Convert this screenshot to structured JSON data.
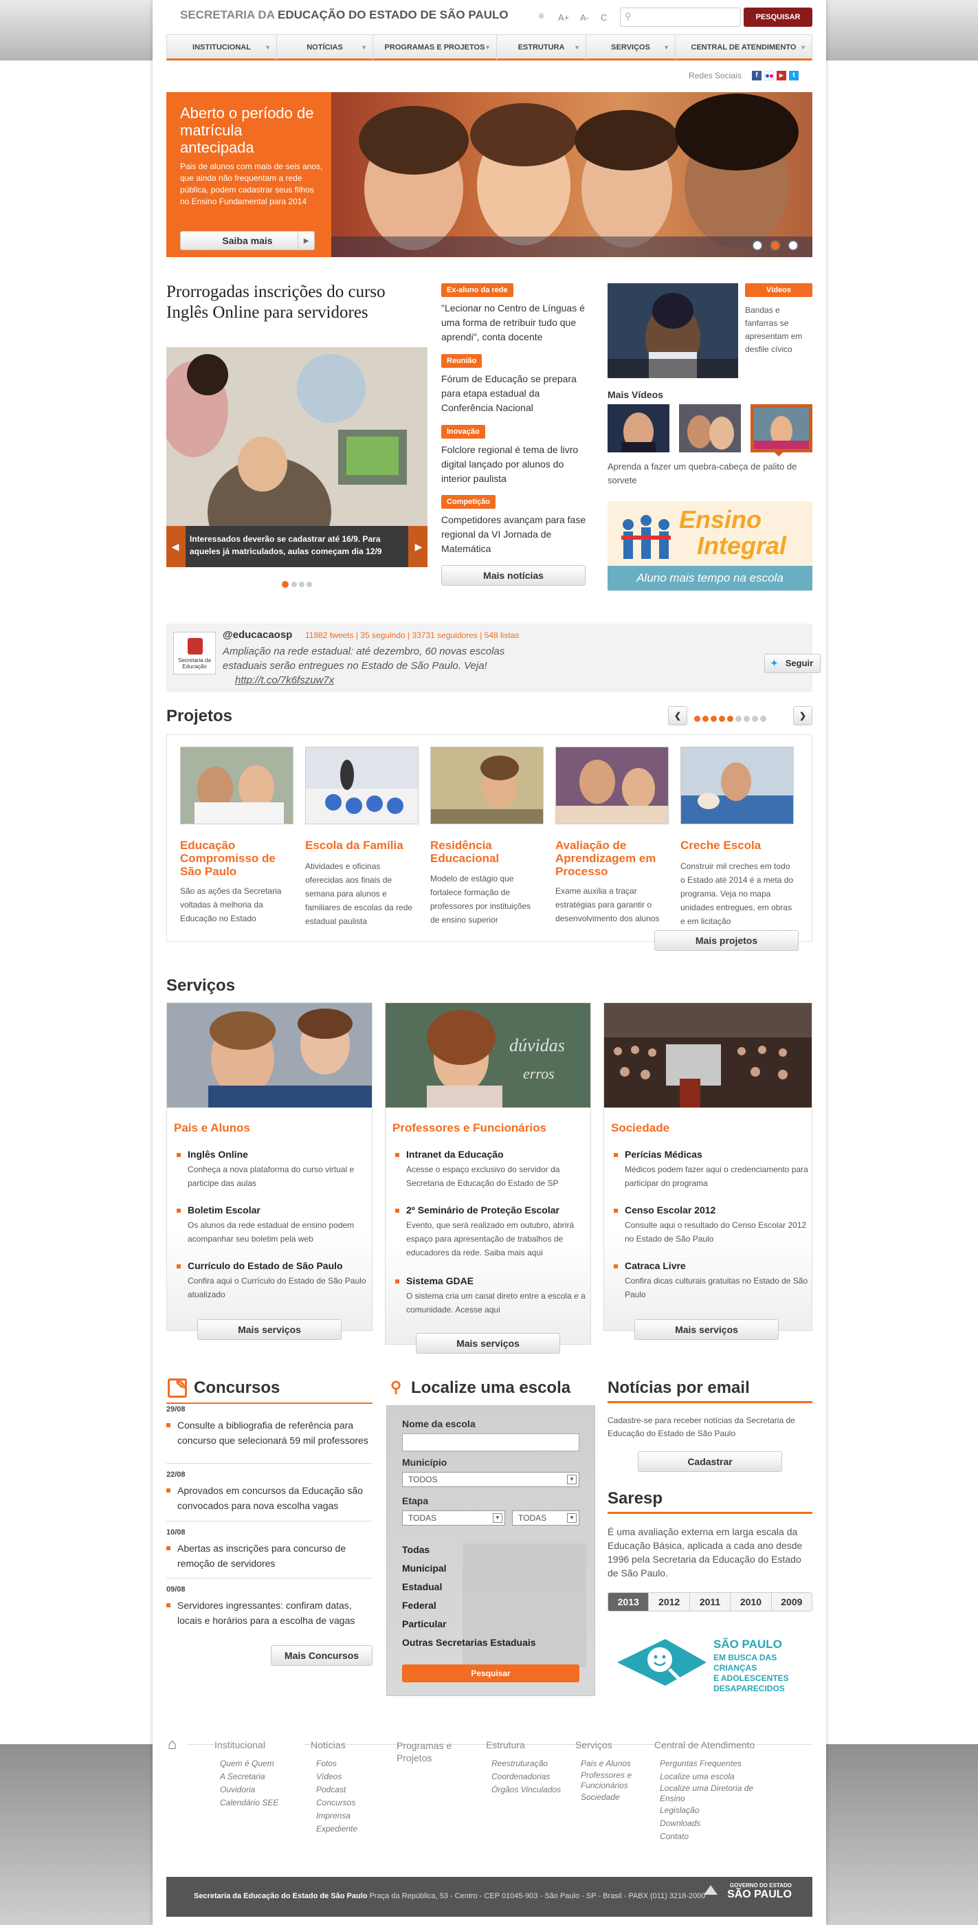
{
  "header": {
    "title_light": "SECRETARIA DA",
    "title_bold": "EDUCAÇÃO DO ESTADO DE SÃO PAULO",
    "font_up": "A+",
    "font_down": "A-",
    "contrast": "C",
    "search_placeholder": "",
    "search_button": "PESQUISAR"
  },
  "nav": {
    "items": [
      {
        "label": "INSTITUCIONAL"
      },
      {
        "label": "NOTÍCIAS"
      },
      {
        "label": "PROGRAMAS E PROJETOS"
      },
      {
        "label": "ESTRUTURA"
      },
      {
        "label": "SERVIÇOS"
      },
      {
        "label": "CENTRAL DE ATENDIMENTO"
      }
    ]
  },
  "social": {
    "label": "Redes Sociais"
  },
  "hero": {
    "title": "Aberto o período de matrícula antecipada",
    "text": "Pais de alunos com mais de seis anos, que ainda não frequentam a rede pública, podem cadastrar seus filhos no Ensino Fundamental para 2014",
    "button": "Saiba mais"
  },
  "news": {
    "headline": "Prorrogadas inscrições do curso Inglês Online para servidores",
    "caption": "Interessados deverão se cadastrar até 16/9. Para aqueles já matriculados, aulas começam dia 12/9",
    "items": [
      {
        "tag": "Ex-aluno da rede",
        "text": "\"Lecionar no Centro de Línguas é uma forma de retribuir tudo que aprendi\", conta docente"
      },
      {
        "tag": "Reunião",
        "text": "Fórum de Educação se prepara para etapa estadual da Conferência Nacional"
      },
      {
        "tag": "Inovação",
        "text": "Folclore regional é tema de livro digital lançado por alunos do interior paulista"
      },
      {
        "tag": "Competição",
        "text": "Competidores avançam para fase regional da VI Jornada de Matemática"
      }
    ],
    "more": "Mais notícias"
  },
  "videos": {
    "tag": "Vídeos",
    "text": "Bandas e fanfarras se apresentam em desfile cívico",
    "more_title": "Mais Vídeos",
    "caption": "Aprenda a fazer um quebra-cabeça de palito de sorvete"
  },
  "banner": {
    "title1": "Ensino",
    "title2": "Integral",
    "subtitle": "Aluno mais tempo na escola"
  },
  "twitter": {
    "handle": "@educacaosp",
    "stats": "11882 tweets | 35 seguindo | 33731 seguidores | 548 listas",
    "tweet": "Ampliação na rede estadual: até dezembro, 60 novas escolas estaduais serão entregues no Estado de São Paulo. Veja!",
    "link": "http://t.co/7k6fszuw7x",
    "follow": "Seguir",
    "avatar_text": "Secretaria da Educação"
  },
  "projects": {
    "title": "Projetos",
    "items": [
      {
        "title": "Educação Compromisso de São Paulo",
        "text": "São as ações da Secretaria voltadas à melhoria da Educação no Estado"
      },
      {
        "title": "Escola da Família",
        "text": "Atividades e oficinas oferecidas aos finais de semana para alunos e familiares de escolas da rede estadual paulista"
      },
      {
        "title": "Residência Educacional",
        "text": "Modelo de estágio que fortalece formação de professores por instituições de ensino superior"
      },
      {
        "title": "Avaliação de Aprendizagem em Processo",
        "text": "Exame auxilia a traçar estratégias para garantir o desenvolvimento dos alunos"
      },
      {
        "title": "Creche Escola",
        "text": "Construir mil creches em todo o Estado até 2014 é a meta do programa. Veja no mapa unidades entregues, em obras e em licitação"
      }
    ],
    "more": "Mais projetos"
  },
  "services": {
    "title": "Serviços",
    "cols": [
      {
        "title": "Pais e Alunos",
        "items": [
          {
            "t": "Inglês Online",
            "d": "Conheça a nova plataforma do curso virtual e participe das aulas"
          },
          {
            "t": "Boletim Escolar",
            "d": "Os alunos da rede estadual de ensino podem acompanhar seu boletim pela web"
          },
          {
            "t": "Currículo do Estado de São Paulo",
            "d": "Confira aqui o Currículo do Estado de São Paulo atualizado"
          }
        ]
      },
      {
        "title": "Professores e Funcionários",
        "items": [
          {
            "t": "Intranet da Educação",
            "d": "Acesse o espaço exclusivo do servidor da Secretaria de Educação do Estado de SP"
          },
          {
            "t": "2º Seminário de Proteção Escolar",
            "d": "Evento, que será realizado em outubro, abrirá espaço para apresentação de trabalhos de educadores da rede. Saiba mais aqui"
          },
          {
            "t": "Sistema GDAE",
            "d": "O sistema cria um canal direto entre a escola e a comunidade. Acesse aqui"
          }
        ]
      },
      {
        "title": "Sociedade",
        "items": [
          {
            "t": "Perícias Médicas",
            "d": "Médicos podem fazer aqui o credenciamento para participar do programa"
          },
          {
            "t": "Censo Escolar 2012",
            "d": "Consulte aqui o resultado do Censo Escolar 2012 no Estado de São Paulo"
          },
          {
            "t": "Catraca Livre",
            "d": "Confira dicas culturais gratuitas no Estado de São Paulo"
          }
        ]
      }
    ],
    "more": "Mais serviços"
  },
  "concursos": {
    "title": "Concursos",
    "items": [
      {
        "date": "29/08",
        "text": "Consulte a bibliografia de referência para concurso que selecionará 59 mil professores"
      },
      {
        "date": "22/08",
        "text": "Aprovados em concursos da Educação são convocados para nova escolha vagas"
      },
      {
        "date": "10/08",
        "text": "Abertas as inscrições para concurso de remoção de servidores"
      },
      {
        "date": "09/08",
        "text": "Servidores ingressantes: confiram datas, locais e horários para a escolha de vagas"
      }
    ],
    "more": "Mais Concursos"
  },
  "localize": {
    "title": "Localize uma escola",
    "name_label": "Nome da escola",
    "mun_label": "Município",
    "mun_value": "TODOS",
    "etapa_label": "Etapa",
    "etapa_value1": "TODAS",
    "etapa_value2": "TODAS",
    "options": [
      "Todas",
      "Municipal",
      "Estadual",
      "Federal",
      "Particular",
      "Outras Secretarias Estaduais"
    ],
    "button": "Pesquisar"
  },
  "email": {
    "title": "Notícias por email",
    "text": "Cadastre-se para receber notícias da Secretaria de Educação do Estado de São Paulo",
    "button": "Cadastrar"
  },
  "saresp": {
    "title": "Saresp",
    "text": "É uma avaliação externa em larga escala da Educação Básica, aplicada a cada ano desde 1996 pela Secretaria da Educação do Estado de São Paulo.",
    "years": [
      "2013",
      "2012",
      "2011",
      "2010",
      "2009"
    ]
  },
  "missing": {
    "title": "SÃO PAULO",
    "line1": "EM BUSCA DAS CRIANÇAS",
    "line2": "E ADOLESCENTES",
    "line3": "DESAPARECIDOS"
  },
  "footer": {
    "cols": [
      {
        "head": "Institucional",
        "links": [
          "Quem é Quem",
          "A Secretaria",
          "Ouvidoria",
          "Calendário SEE"
        ]
      },
      {
        "head": "Notícias",
        "links": [
          "Fotos",
          "Vídeos",
          "Podcast",
          "Concursos",
          "Imprensa",
          "Expediente"
        ]
      },
      {
        "head": "Programas e Projetos",
        "links": []
      },
      {
        "head": "Estrutura",
        "links": [
          "Reestruturação",
          "Coordenadorias",
          "Órgãos Vinculados"
        ]
      },
      {
        "head": "Serviços",
        "links": [
          "Pais e Alunos",
          "Professores e Funcionários",
          "Sociedade"
        ]
      },
      {
        "head": "Central de Atendimento",
        "links": [
          "Perguntas Frequentes",
          "Localize uma escola",
          "Localize uma Diretoria de Ensino",
          "Legislação",
          "Downloads",
          "Contato"
        ]
      }
    ],
    "bar_bold": "Secretaria da Educação do Estado de São Paulo",
    "bar_text": "Praça da República, 53 - Centro - CEP 01045-903 - São Paulo - SP - Brasil - PABX (011) 3218-2000",
    "gov_small": "GOVERNO DO ESTADO",
    "gov_big": "SÃO PAULO"
  },
  "colors": {
    "accent": "#f26d21",
    "search_btn": "#8b1a1a"
  }
}
